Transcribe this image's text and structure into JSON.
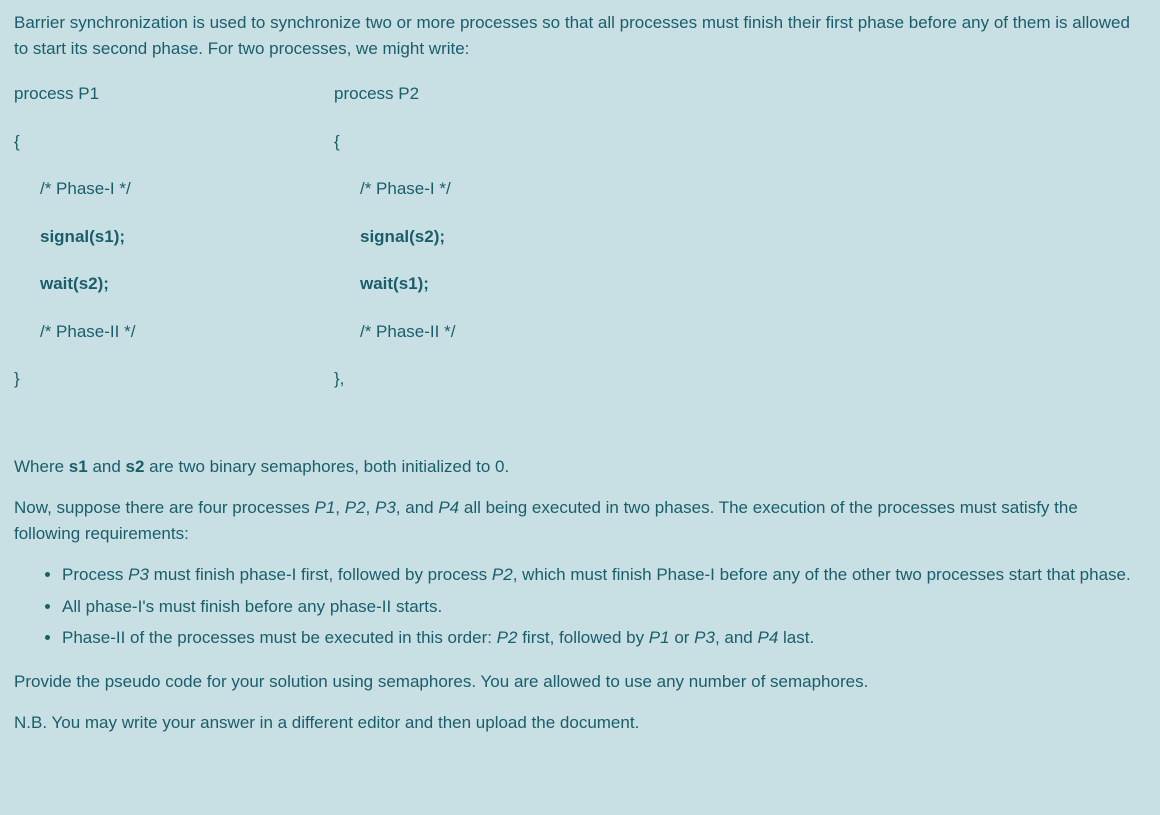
{
  "intro": {
    "p1": "Barrier synchronization is used to synchronize two or more processes so that all processes must finish their first phase before any of them is allowed to start its second phase. For two processes, we might write:"
  },
  "code": {
    "col1_header": "process P1",
    "col2_header": "process P2",
    "col1": {
      "open": "{",
      "phase1": "/* Phase-I */",
      "signal": "signal(s1);",
      "wait": "wait(s2);",
      "phase2": "/* Phase-II */",
      "close": "}"
    },
    "col2": {
      "open": "{",
      "phase1": "/* Phase-I */",
      "signal": "signal(s2);",
      "wait": "wait(s1);",
      "phase2": "/* Phase-II */",
      "close": "},"
    }
  },
  "explanation": {
    "where_prefix": "Where ",
    "s1": "s1",
    "and": " and ",
    "s2": "s2",
    "where_suffix": " are two binary semaphores, both initialized to 0.",
    "now_prefix": "Now, suppose there are four processes ",
    "p1": "P1",
    "comma1": ", ",
    "p2": "P2",
    "comma2": ", ",
    "p3": "P3",
    "comma_and": ", and ",
    "p4": "P4",
    "now_suffix": " all being executed in two phases. The execution of the processes must satisfy the following requirements:"
  },
  "requirements": {
    "r1_prefix": "Process ",
    "r1_p3": "P3",
    "r1_mid1": " must finish phase-I first, followed by process ",
    "r1_p2": "P2",
    "r1_suffix": ", which must finish Phase-I before any of the other two processes start that phase.",
    "r2": "All phase-I's must finish before any phase-II starts.",
    "r3_prefix": "Phase-II of the processes must be executed in this order: ",
    "r3_p2": "P2",
    "r3_mid1": " first, followed by ",
    "r3_p1": "P1",
    "r3_or": " or ",
    "r3_p3": "P3",
    "r3_and": ", and ",
    "r3_p4": "P4",
    "r3_suffix": " last."
  },
  "closing": {
    "p1": "Provide the pseudo code for your solution using semaphores. You are allowed to use any number of semaphores.",
    "p2": "N.B. You may write your answer in a different editor and then upload the document."
  }
}
